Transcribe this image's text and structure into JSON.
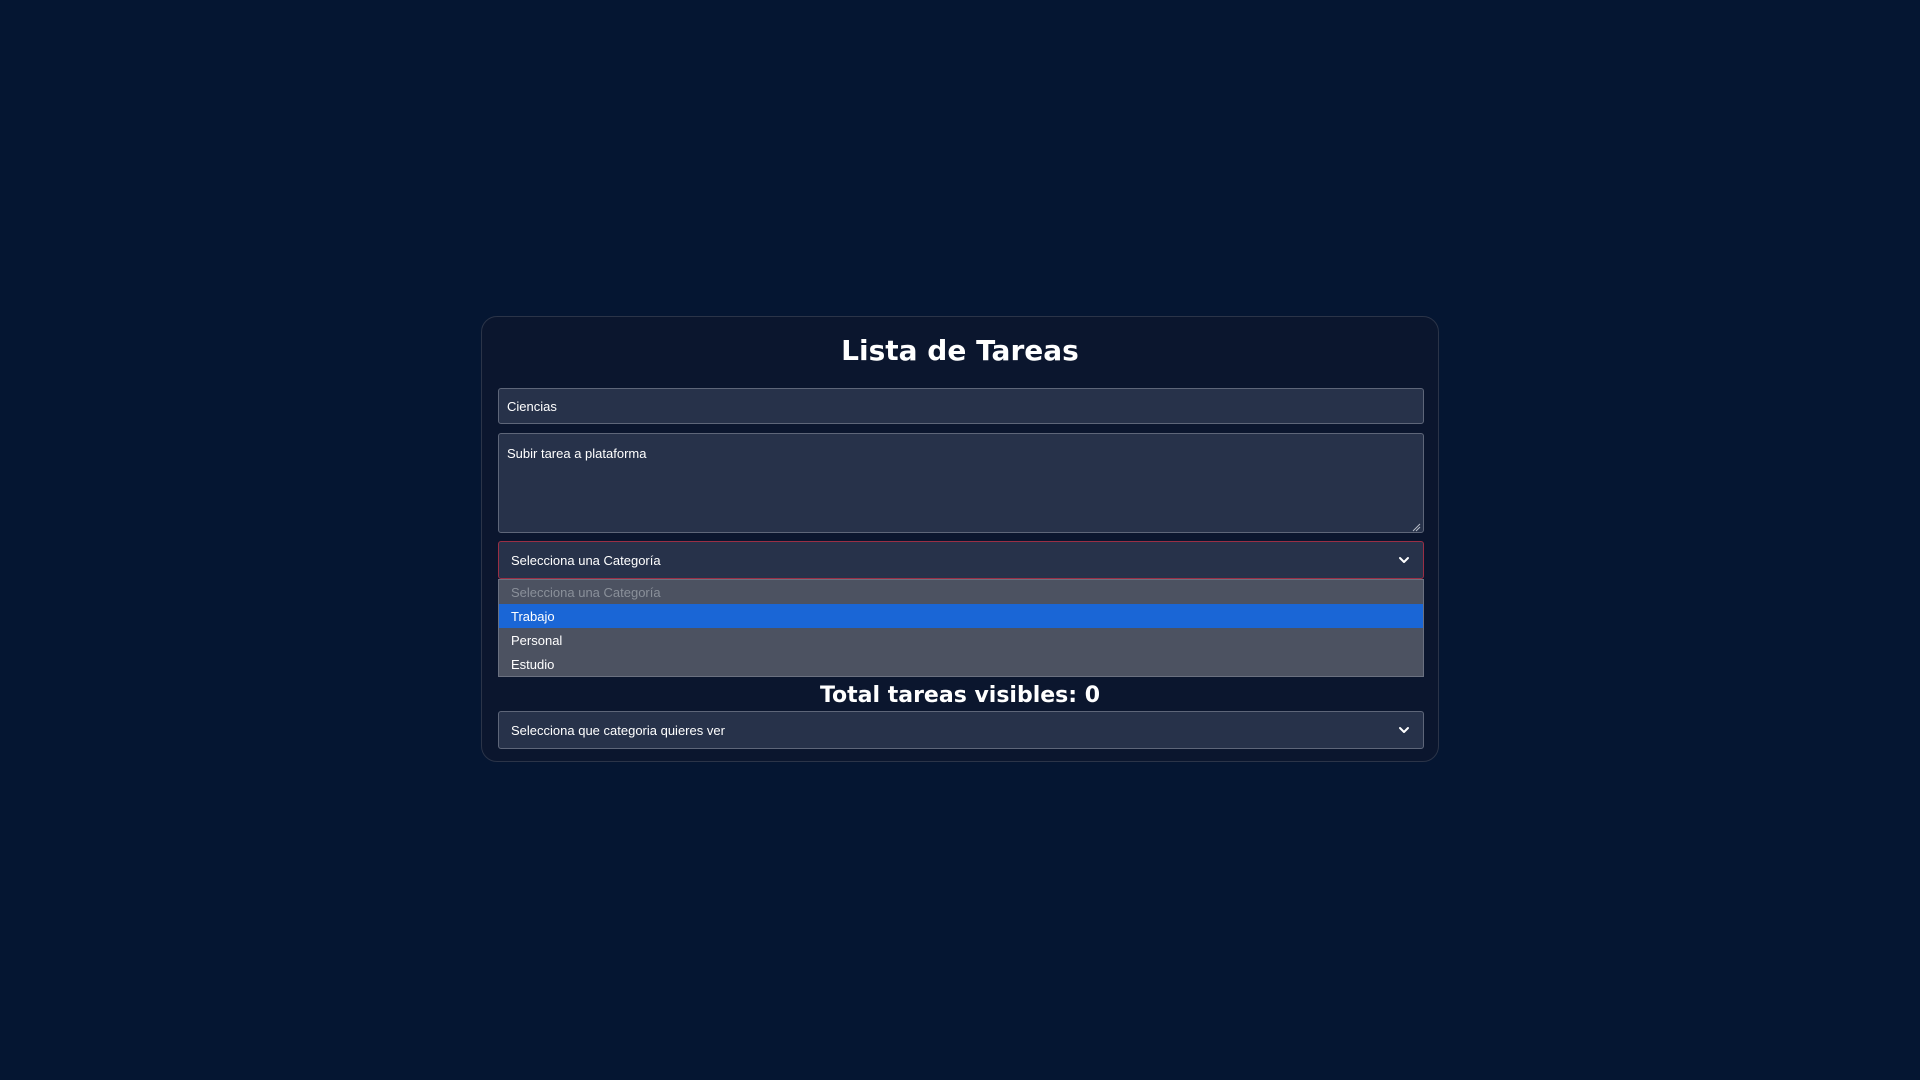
{
  "app": {
    "title": "Lista de Tareas"
  },
  "form": {
    "task_name_value": "Ciencias",
    "task_description_value": "Subir tarea a plataforma",
    "category_select": {
      "selected_label": "Selecciona una Categoría",
      "options": [
        {
          "label": "Selecciona una Categoría",
          "disabled": true
        },
        {
          "label": "Trabajo",
          "highlighted": true
        },
        {
          "label": "Personal"
        },
        {
          "label": "Estudio"
        }
      ]
    }
  },
  "summary": {
    "total_visible_label": "Total tareas visibles: 0"
  },
  "filter": {
    "selected_label": "Selecciona que categoria quieres ver"
  },
  "icons": {
    "chevron_down": "chevron-down-icon",
    "resize_handle": "resize-handle-icon"
  },
  "colors": {
    "background": "#051632",
    "card": "#0b162e",
    "field": "#27324a",
    "dropdown": "#4c5261",
    "highlight": "#1a66d6",
    "focus_border": "#9a2f45"
  }
}
